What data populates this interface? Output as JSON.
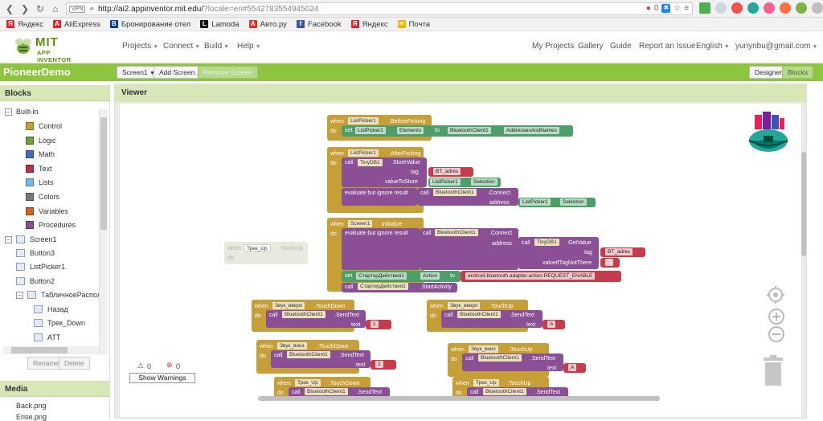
{
  "browser": {
    "vpn": "VPN",
    "url_host": "http://ai2.appinventor.mit.edu/",
    "url_path": "?locale=en#5542783554945024",
    "badge_count": "0",
    "bookmarks": [
      {
        "label": "Яндекс",
        "color": "#e4232b",
        "glyph": "Я"
      },
      {
        "label": "AliExpress",
        "color": "#e4232b",
        "glyph": "A"
      },
      {
        "label": "Бронирование отел",
        "color": "#003b95",
        "glyph": "B"
      },
      {
        "label": "Lamoda",
        "color": "#111111",
        "glyph": "L"
      },
      {
        "label": "Авто.ру",
        "color": "#db3727",
        "glyph": "A"
      },
      {
        "label": "Facebook",
        "color": "#3b5998",
        "glyph": "f"
      },
      {
        "label": "Яндекс",
        "color": "#e4232b",
        "glyph": "Я"
      },
      {
        "label": "Почта",
        "color": "#f5b400",
        "glyph": "✉"
      }
    ]
  },
  "appinventor": {
    "logo_title": "MIT",
    "logo_sub": "APP INVENTOR",
    "menus": [
      "Projects",
      "Connect",
      "Build",
      "Help"
    ],
    "right_links": [
      "My Projects",
      "Gallery",
      "Guide",
      "Report an Issue",
      "English"
    ],
    "user": "yuriynbu@gmail.com"
  },
  "toolbar": {
    "project": "PioneerDemo",
    "screen_select": "Screen1",
    "add_screen": "Add Screen ...",
    "remove_screen": "Remove Screen",
    "designer": "Designer",
    "blocks": "Blocks"
  },
  "blocks_panel": {
    "header": "Blocks",
    "builtin_label": "Built-in",
    "builtin": [
      {
        "label": "Control",
        "color": "#c69f38"
      },
      {
        "label": "Logic",
        "color": "#6f9e3a"
      },
      {
        "label": "Math",
        "color": "#3f6fb5"
      },
      {
        "label": "Text",
        "color": "#b5324a"
      },
      {
        "label": "Lists",
        "color": "#7ab7e0"
      },
      {
        "label": "Colors",
        "color": "#7a7a7a"
      },
      {
        "label": "Variables",
        "color": "#d0642b"
      },
      {
        "label": "Procedures",
        "color": "#8a4f94"
      }
    ],
    "screen": "Screen1",
    "components": [
      "Button3",
      "ListPicker1",
      "Button2"
    ],
    "table_layout": "ТабличноеРасположе",
    "table_children": [
      "Назад",
      "Трек_Down",
      "ATT"
    ],
    "rename": "Rename",
    "delete": "Delete",
    "media_header": "Media",
    "media": [
      "Back.png",
      "Erise.png"
    ]
  },
  "viewer": {
    "header": "Viewer",
    "warnings_count": "0",
    "errors_count": "0",
    "show_warnings": "Show Warnings"
  },
  "code": {
    "w": "when",
    "do": "do",
    "set": "set",
    "call": "call",
    "to": "to",
    "tag": "tag",
    "valueToStore": "valueToStore",
    "address": "address",
    "text": "text",
    "valueIfTagNotThere": "valueIfTagNotThere",
    "eval": "evaluate but ignore result",
    "lp1": "ListPicker1",
    "bp": ".BeforePicking",
    "ap": ".AfterPicking",
    "elements": "Elements",
    "bt": "BluetoothClient1",
    "addr_names": "AddressesAndNames",
    "tinydb": "TinyDB1",
    "store": ".StoreValue",
    "getv": ".GetValue",
    "bt_adres": "BT_adres",
    "selection": "Selection",
    "connect": ".Connect",
    "scr": "Screen1",
    "init": ".Initialize",
    "starter": "СтартерДействия1",
    "action": "Action",
    "req": "android.bluetooth.adapter.action.REQUEST_ENABLE",
    "start": ".StartActivity",
    "send": ".SendText",
    "touchdown": ".TouchDown",
    "touchup": ".TouchUp",
    "up_btn": "Звук_вверх",
    "down_btn": "Звук_вниз",
    "trek_up": "Трек_Up",
    "s1": "1",
    "s2": "2",
    "sA": "A",
    "sEmpty": ""
  }
}
